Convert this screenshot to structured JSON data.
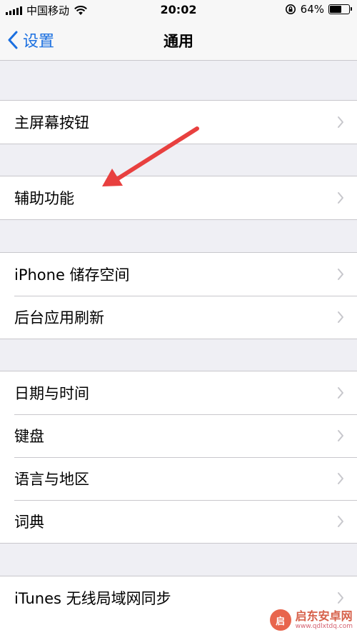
{
  "status_bar": {
    "carrier": "中国移动",
    "time": "20:02",
    "battery_percent": "64%",
    "battery_level": 0.64,
    "icons": [
      "signal-icon",
      "wifi-icon",
      "rotation-lock-icon",
      "battery-icon"
    ]
  },
  "nav": {
    "back_label": "设置",
    "title": "通用"
  },
  "groups": [
    {
      "items": [
        {
          "label": "主屏幕按钮"
        }
      ]
    },
    {
      "items": [
        {
          "label": "辅助功能"
        }
      ]
    },
    {
      "items": [
        {
          "label": "iPhone 储存空间"
        },
        {
          "label": "后台应用刷新"
        }
      ]
    },
    {
      "items": [
        {
          "label": "日期与时间"
        },
        {
          "label": "键盘"
        },
        {
          "label": "语言与地区"
        },
        {
          "label": "词典"
        }
      ]
    },
    {
      "items": [
        {
          "label": "iTunes 无线局域网同步"
        }
      ]
    }
  ],
  "colors": {
    "accent": "#1a6fe0",
    "annotation_arrow": "#e8403f",
    "background": "#efeff4"
  },
  "watermark": {
    "name": "启东安卓网",
    "url": "www.qdlxtdq.com",
    "logo_text": "启东"
  }
}
